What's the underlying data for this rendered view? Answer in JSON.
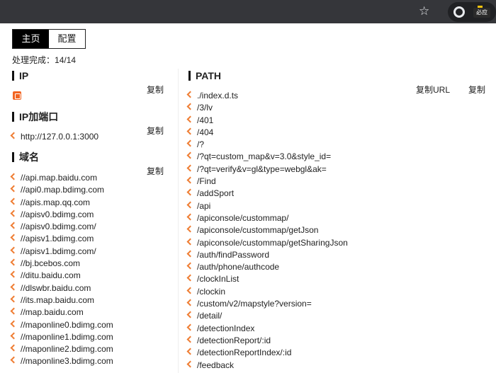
{
  "browser": {
    "star_icon": "star-icon",
    "extension_badge": "必应"
  },
  "tabs": [
    {
      "label": "主页",
      "active": true
    },
    {
      "label": "配置",
      "active": false
    }
  ],
  "status": {
    "label": "处理完成：",
    "value": "14/14"
  },
  "ip": {
    "title": "IP",
    "copy": "复制"
  },
  "ip_port": {
    "title": "IP加端口",
    "copy": "复制",
    "items": [
      "http://127.0.0.1:3000"
    ]
  },
  "domain": {
    "title": "域名",
    "copy": "复制",
    "items": [
      "//api.map.baidu.com",
      "//api0.map.bdimg.com",
      "//apis.map.qq.com",
      "//apisv0.bdimg.com",
      "//apisv0.bdimg.com/",
      "//apisv1.bdimg.com",
      "//apisv1.bdimg.com/",
      "//bj.bcebos.com",
      "//ditu.baidu.com",
      "//dlswbr.baidu.com",
      "//its.map.baidu.com",
      "//map.baidu.com",
      "//maponline0.bdimg.com",
      "//maponline1.bdimg.com",
      "//maponline2.bdimg.com",
      "//maponline3.bdimg.com"
    ]
  },
  "path": {
    "title": "PATH",
    "copy_url": "复制URL",
    "copy": "复制",
    "items": [
      "./index.d.ts",
      "/3/lv",
      "/401",
      "/404",
      "/?",
      "/?qt=custom_map&v=3.0&style_id=",
      "/?qt=verify&v=gl&type=webgl&ak=",
      "/Find",
      "/addSport",
      "/api",
      "/apiconsole/custommap/",
      "/apiconsole/custommap/getJson",
      "/apiconsole/custommap/getSharingJson",
      "/auth/findPassword",
      "/auth/phone/authcode",
      "/clockInList",
      "/clockin",
      "/custom/v2/mapstyle?version=",
      "/detail/",
      "/detectionIndex",
      "/detectionReport/:id",
      "/detectionReportIndex/:id",
      "/feedback"
    ]
  }
}
